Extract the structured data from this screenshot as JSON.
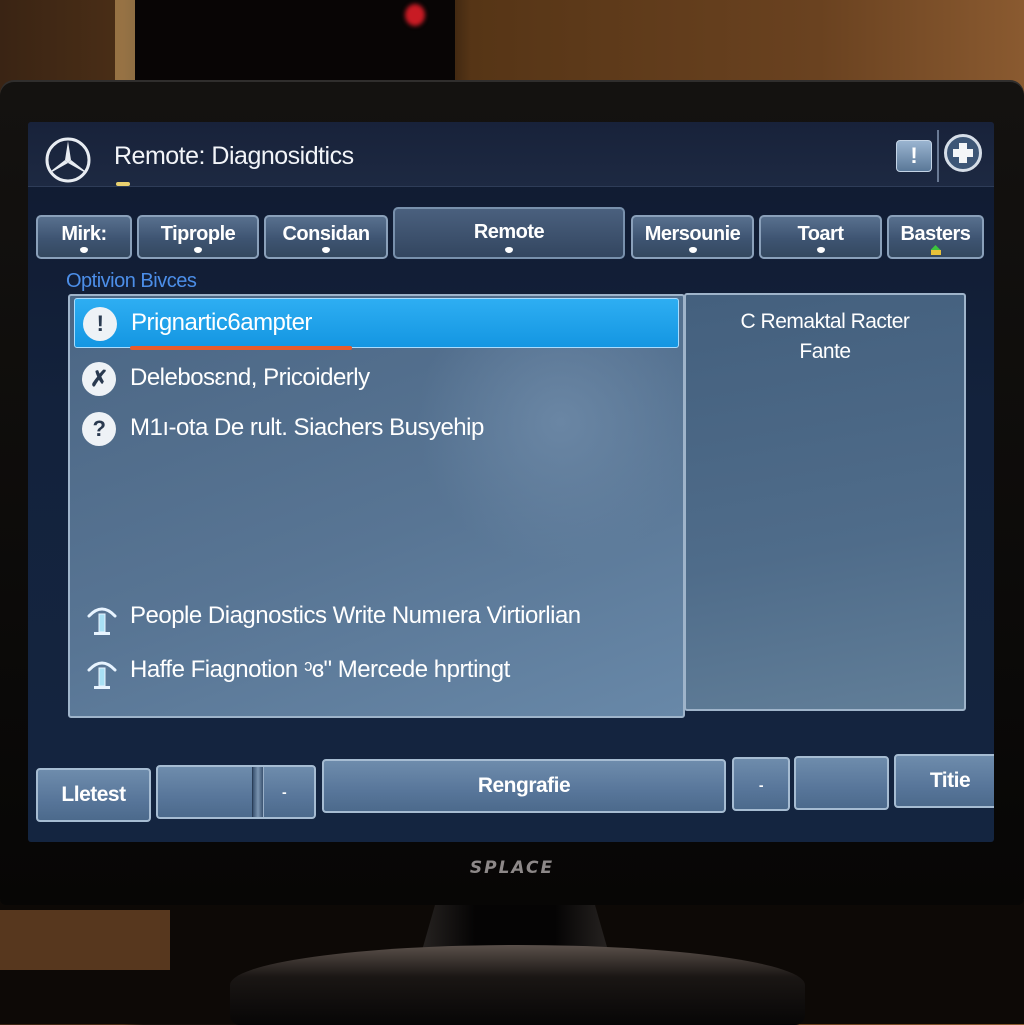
{
  "window": {
    "title": "Remote: Diagnosidtics",
    "logo": "mercedes-star-icon",
    "alert_icon_label": "!",
    "add_icon": "plus-circle-icon"
  },
  "tabs": [
    {
      "label": "Mirk:",
      "indicator": "dot"
    },
    {
      "label": "Tiprople",
      "indicator": "dot"
    },
    {
      "label": "Considan",
      "indicator": "dot"
    },
    {
      "label": "Remote",
      "indicator": "dot",
      "active": true
    },
    {
      "label": "Mersounie",
      "indicator": "dot"
    },
    {
      "label": "Toart",
      "indicator": "dot"
    },
    {
      "label": "Basters",
      "indicator": "green-yellow-badge"
    }
  ],
  "section_label": "Optivion Bivces",
  "list": {
    "items": [
      {
        "icon": "exclamation-icon",
        "glyph": "!",
        "label": "Prignartic6ampter",
        "selected": true
      },
      {
        "icon": "tools-icon",
        "glyph": "✗",
        "label": "Delebosɛnd, Pricoiderly"
      },
      {
        "icon": "question-icon",
        "glyph": "?",
        "label": "M1ı-ota De rult. Siachers Busyehip"
      },
      {
        "icon": "antenna-icon",
        "label": "People Diagnostics Write Numıera Virtiorlian"
      },
      {
        "icon": "antenna-icon",
        "label": "Haffe Fiagnotion ᵓɞ\" Mercede hprtingt"
      }
    ]
  },
  "side_panel": {
    "title_line1": "C Remaktal Racter",
    "title_line2": "Fante"
  },
  "bottom_bar": {
    "detest_label": "Lletest",
    "slider_minus": "-",
    "rengrafie_label": "Rengrafie",
    "small_minus": "-",
    "blank_button": "",
    "title_label": "Titie"
  },
  "monitor": {
    "brand": "SPLACE"
  },
  "colors": {
    "accent_selected": "#1aa2ea",
    "section_label": "#4c8ee8",
    "underline": "#e85a2a"
  }
}
